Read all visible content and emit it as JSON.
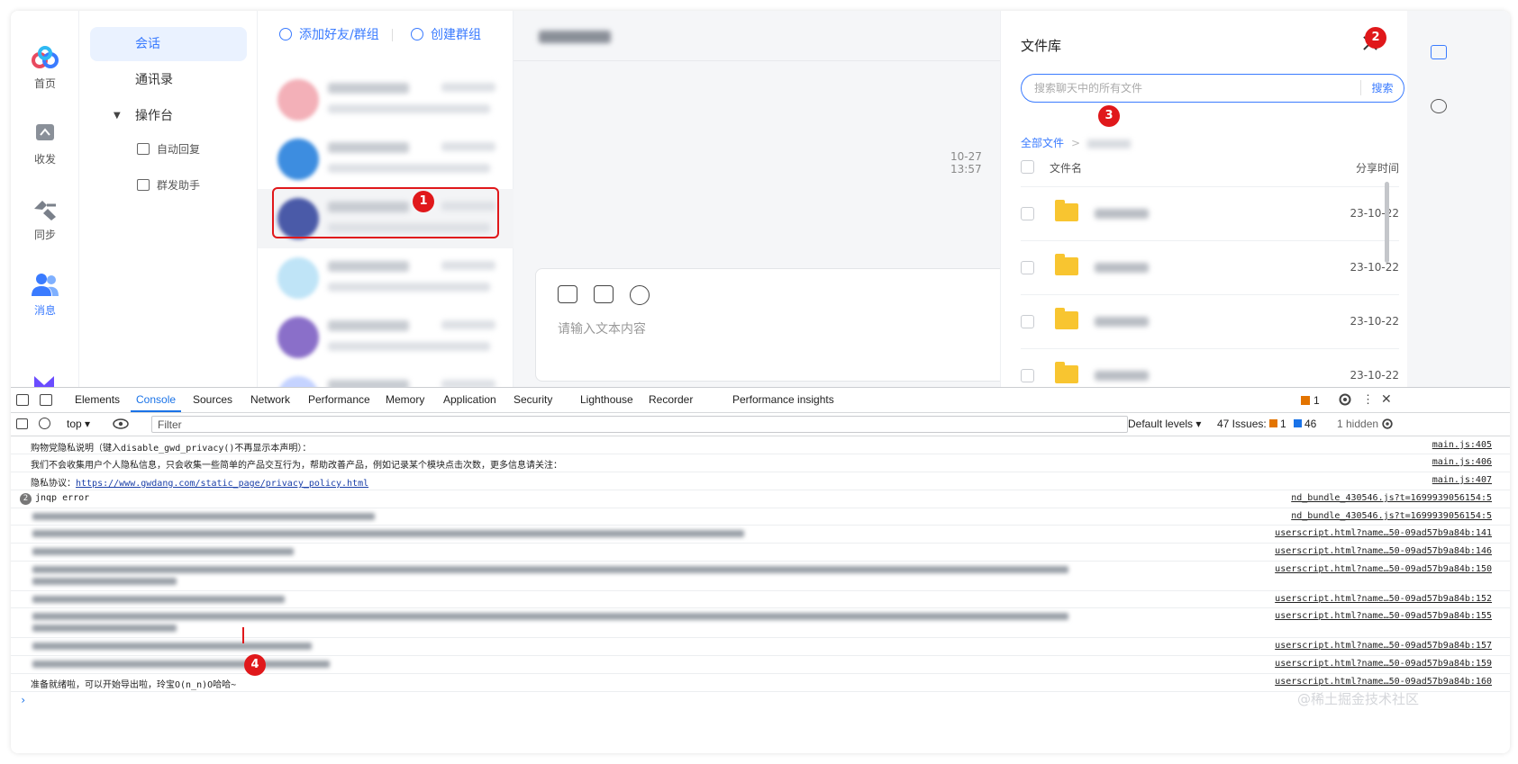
{
  "rail": {
    "items": [
      {
        "label": "首页",
        "icon": "cloud-logo-icon"
      },
      {
        "label": "收发",
        "icon": "send-receive-icon"
      },
      {
        "label": "同步",
        "icon": "sync-icon"
      },
      {
        "label": "消息",
        "icon": "users-icon"
      }
    ]
  },
  "nav": {
    "items": [
      "会话",
      "通讯录",
      "操作台"
    ],
    "subitems": [
      "自动回复",
      "群发助手"
    ]
  },
  "list": {
    "add_friend": "添加好友/群组",
    "create_group": "创建群组"
  },
  "chat": {
    "timestamp": "10-27 13:57",
    "input_placeholder": "请输入文本内容"
  },
  "files": {
    "title": "文件库",
    "search_placeholder": "搜索聊天中的所有文件",
    "search_button": "搜索",
    "breadcrumb_root": "全部文件",
    "col_name": "文件名",
    "col_time": "分享时间",
    "rows": [
      {
        "date": "23-10-22"
      },
      {
        "date": "23-10-22"
      },
      {
        "date": "23-10-22"
      },
      {
        "date": "23-10-22"
      }
    ]
  },
  "annotations": [
    "1",
    "2",
    "3",
    "4"
  ],
  "devtools": {
    "tabs": [
      "Elements",
      "Console",
      "Sources",
      "Network",
      "Performance",
      "Memory",
      "Application",
      "Security",
      "Lighthouse",
      "Recorder",
      "Performance insights"
    ],
    "issues_badge": "1",
    "context": "top",
    "filter_placeholder": "Filter",
    "levels": "Default levels ▾",
    "issues_label": "47 Issues:",
    "issues_warn": "1",
    "issues_info": "46",
    "hidden": "1 hidden",
    "lines": [
      {
        "text": "购物党隐私说明（键入disable_gwd_privacy()不再显示本声明）：",
        "src": "main.js:405"
      },
      {
        "text": "      我们不会收集用户个人隐私信息，只会收集一些简单的产品交互行为，帮助改善产品，例如记录某个模块点击次数，更多信息请关注：",
        "src": "main.js:406"
      },
      {
        "text": "隐私协议：",
        "link": "https://www.gwdang.com/static_page/privacy_policy.html",
        "src": "main.js:407"
      },
      {
        "count": "2",
        "text": "jnqp error",
        "src": "nd_bundle_430546.js?t=1699939056154:5"
      },
      {
        "src": "nd_bundle_430546.js?t=1699939056154:5"
      },
      {
        "src": "userscript.html?name…50-09ad57b9a84b:141"
      },
      {
        "src": "userscript.html?name…50-09ad57b9a84b:146"
      },
      {
        "src": "userscript.html?name…50-09ad57b9a84b:150"
      },
      {
        "src": "userscript.html?name…50-09ad57b9a84b:152"
      },
      {
        "src": "userscript.html?name…50-09ad57b9a84b:155"
      },
      {
        "src": "userscript.html?name…50-09ad57b9a84b:157"
      },
      {
        "src": "userscript.html?name…50-09ad57b9a84b:159"
      },
      {
        "text": "准备就绪啦，可以开始导出啦，玲宝O(n_n)O哈哈~",
        "src": "userscript.html?name…50-09ad57b9a84b:160"
      }
    ],
    "prompt": "›"
  },
  "watermark": "@稀土掘金技术社区"
}
